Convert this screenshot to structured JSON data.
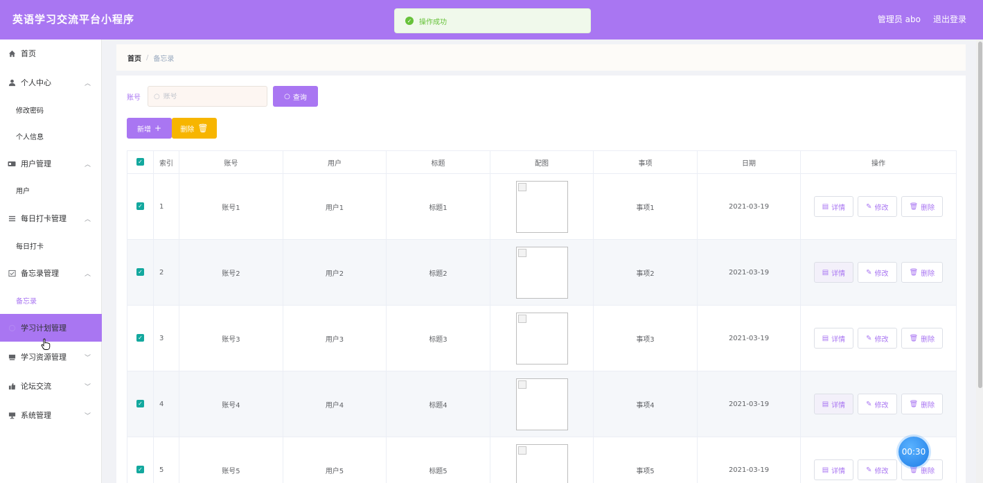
{
  "header": {
    "title": "英语学习交流平台小程序",
    "admin_label": "管理员 abo",
    "logout_label": "退出登录"
  },
  "toast": {
    "message": "操作成功"
  },
  "sidebar": {
    "items": [
      {
        "label": "首页",
        "icon": "home-icon"
      },
      {
        "label": "个人中心",
        "icon": "user-icon"
      },
      {
        "label": "修改密码"
      },
      {
        "label": "个人信息"
      },
      {
        "label": "用户管理",
        "icon": "users-icon"
      },
      {
        "label": "用户"
      },
      {
        "label": "每日打卡管理",
        "icon": "list-icon"
      },
      {
        "label": "每日打卡"
      },
      {
        "label": "备忘录管理",
        "icon": "memo-icon"
      },
      {
        "label": "备忘录"
      },
      {
        "label": "学习计划管理",
        "icon": "plan-icon"
      },
      {
        "label": "学习资源管理",
        "icon": "book-icon"
      },
      {
        "label": "论坛交流",
        "icon": "forum-icon"
      },
      {
        "label": "系统管理",
        "icon": "system-icon"
      }
    ]
  },
  "breadcrumb": {
    "home": "首页",
    "separator": "/",
    "current": "备忘录"
  },
  "search": {
    "label": "账号",
    "placeholder": "账号",
    "value": "",
    "button_label": "查询"
  },
  "toolbar": {
    "add_label": "新增",
    "delete_label": "删除"
  },
  "table": {
    "columns": [
      "索引",
      "账号",
      "用户",
      "标题",
      "配图",
      "事项",
      "日期",
      "操作"
    ],
    "rows": [
      {
        "index": "1",
        "account": "账号1",
        "user": "用户1",
        "title": "标题1",
        "item": "事项1",
        "date": "2021-03-19"
      },
      {
        "index": "2",
        "account": "账号2",
        "user": "用户2",
        "title": "标题2",
        "item": "事项2",
        "date": "2021-03-19"
      },
      {
        "index": "3",
        "account": "账号3",
        "user": "用户3",
        "title": "标题3",
        "item": "事项3",
        "date": "2021-03-19"
      },
      {
        "index": "4",
        "account": "账号4",
        "user": "用户4",
        "title": "标题4",
        "item": "事项4",
        "date": "2021-03-19"
      },
      {
        "index": "5",
        "account": "账号5",
        "user": "用户5",
        "title": "标题5",
        "item": "事项5",
        "date": "2021-03-19"
      }
    ],
    "actions": {
      "detail": "详情",
      "edit": "修改",
      "delete": "删除"
    }
  },
  "timer": {
    "text": "00:30"
  },
  "colors": {
    "accent": "#a976f2",
    "warning": "#f7b500",
    "success": "#67c23a",
    "check": "#13a89e"
  }
}
